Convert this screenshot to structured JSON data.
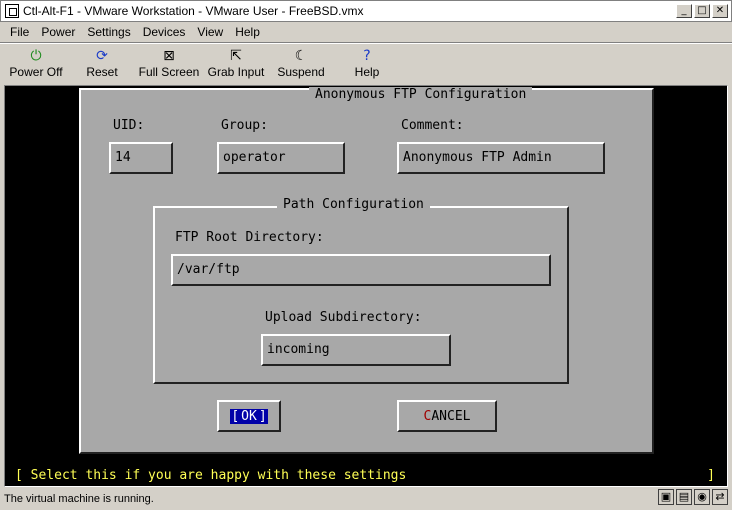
{
  "window": {
    "title": "Ctl-Alt-F1 - VMware Workstation - VMware User - FreeBSD.vmx",
    "minimize": "_",
    "maximize": "□",
    "close": "✕"
  },
  "menu": [
    "File",
    "Power",
    "Settings",
    "Devices",
    "View",
    "Help"
  ],
  "toolbar": [
    {
      "label": "Power Off",
      "icon": "power-icon",
      "glyph": "⏻",
      "color": "#1c8a1c"
    },
    {
      "label": "Reset",
      "icon": "reset-icon",
      "glyph": "⟳",
      "color": "#1c3cc8"
    },
    {
      "label": "Full Screen",
      "icon": "fullscreen-icon",
      "glyph": "⊠",
      "color": "#000000"
    },
    {
      "label": "Grab Input",
      "icon": "cursor-icon",
      "glyph": "⇱",
      "color": "#000000"
    },
    {
      "label": "Suspend",
      "icon": "moon-icon",
      "glyph": "☾",
      "color": "#000000"
    },
    {
      "label": "Help",
      "icon": "help-icon",
      "glyph": "?",
      "color": "#1c3cc8"
    }
  ],
  "dialog": {
    "title": "Anonymous FTP Configuration",
    "uid_label": "UID:",
    "uid_value": "14",
    "group_label": "Group:",
    "group_value": "operator",
    "comment_label": "Comment:",
    "comment_value": "Anonymous FTP Admin",
    "path_title": "Path Configuration",
    "root_label": "FTP Root Directory:",
    "root_value": "/var/ftp",
    "upload_label": "Upload Subdirectory:",
    "upload_value": "incoming",
    "ok_left": "[",
    "ok_text": "OK",
    "ok_right": "]",
    "cancel_hot": "C",
    "cancel_rest": "ANCEL"
  },
  "console_status": "[ Select this if you are happy with these settings",
  "console_status_end": "]",
  "statusbar": {
    "text": "The virtual machine is running.",
    "icons": [
      {
        "name": "floppy-icon",
        "glyph": "▣"
      },
      {
        "name": "disk-icon",
        "glyph": "▤"
      },
      {
        "name": "cdrom-icon",
        "glyph": "◉"
      },
      {
        "name": "network-icon",
        "glyph": "⇄"
      }
    ]
  }
}
